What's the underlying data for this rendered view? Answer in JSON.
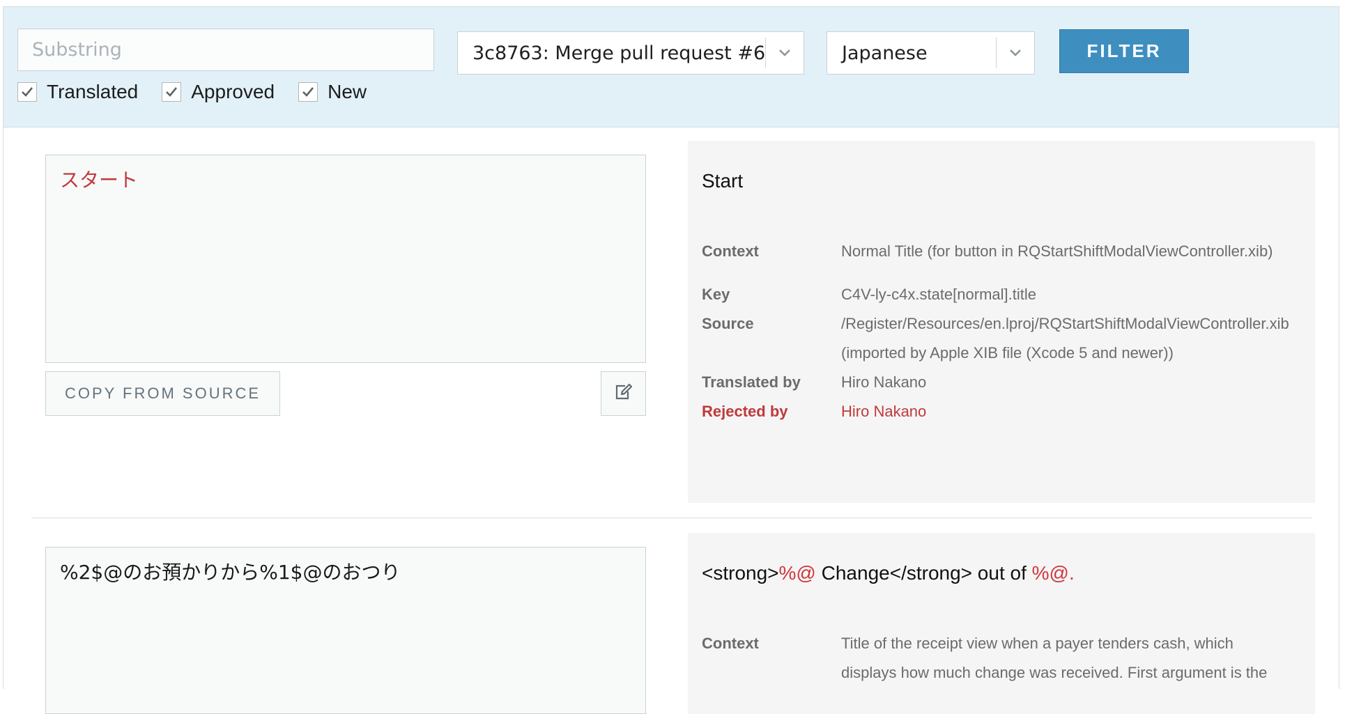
{
  "filter": {
    "substring_placeholder": "Substring",
    "substring_value": "",
    "commit": "3c8763: Merge pull request #6",
    "language": "Japanese",
    "button_label": "FILTER",
    "checkboxes": [
      {
        "label": "Translated",
        "checked": true
      },
      {
        "label": "Approved",
        "checked": true
      },
      {
        "label": "New",
        "checked": true
      }
    ]
  },
  "entries": [
    {
      "translation": "スタート",
      "copy_label": "COPY FROM SOURCE",
      "source": "Start",
      "context_label": "Context",
      "context": "Normal Title (for button in RQStartShiftModalViewController.xib)",
      "key_label": "Key",
      "key": "C4V-ly-c4x.state[normal].title",
      "source_label": "Source",
      "source_path": "/Register/Resources/en.lproj/RQStartShiftModalViewController.xib",
      "source_importer": "(imported by Apple XIB file (Xcode 5 and newer))",
      "translated_by_label": "Translated by",
      "translated_by": "Hiro Nakano",
      "rejected_by_label": "Rejected by",
      "rejected_by": "Hiro Nakano"
    },
    {
      "translation": "%2$@のお預かりから%1$@のおつり",
      "source_parts": [
        "<strong>",
        "%@",
        " Change</strong> out of ",
        "%@",
        "."
      ],
      "context_label": "Context",
      "context_line1": "Title of the receipt view when a payer tenders cash, which",
      "context_line2": "displays how much change was received. First argument is the"
    }
  ],
  "colors": {
    "filter_bar": "#e2f1f7",
    "filter_button": "#3e8fc0",
    "rejected": "#c0393b",
    "placeholder_token": "#d0363c"
  }
}
